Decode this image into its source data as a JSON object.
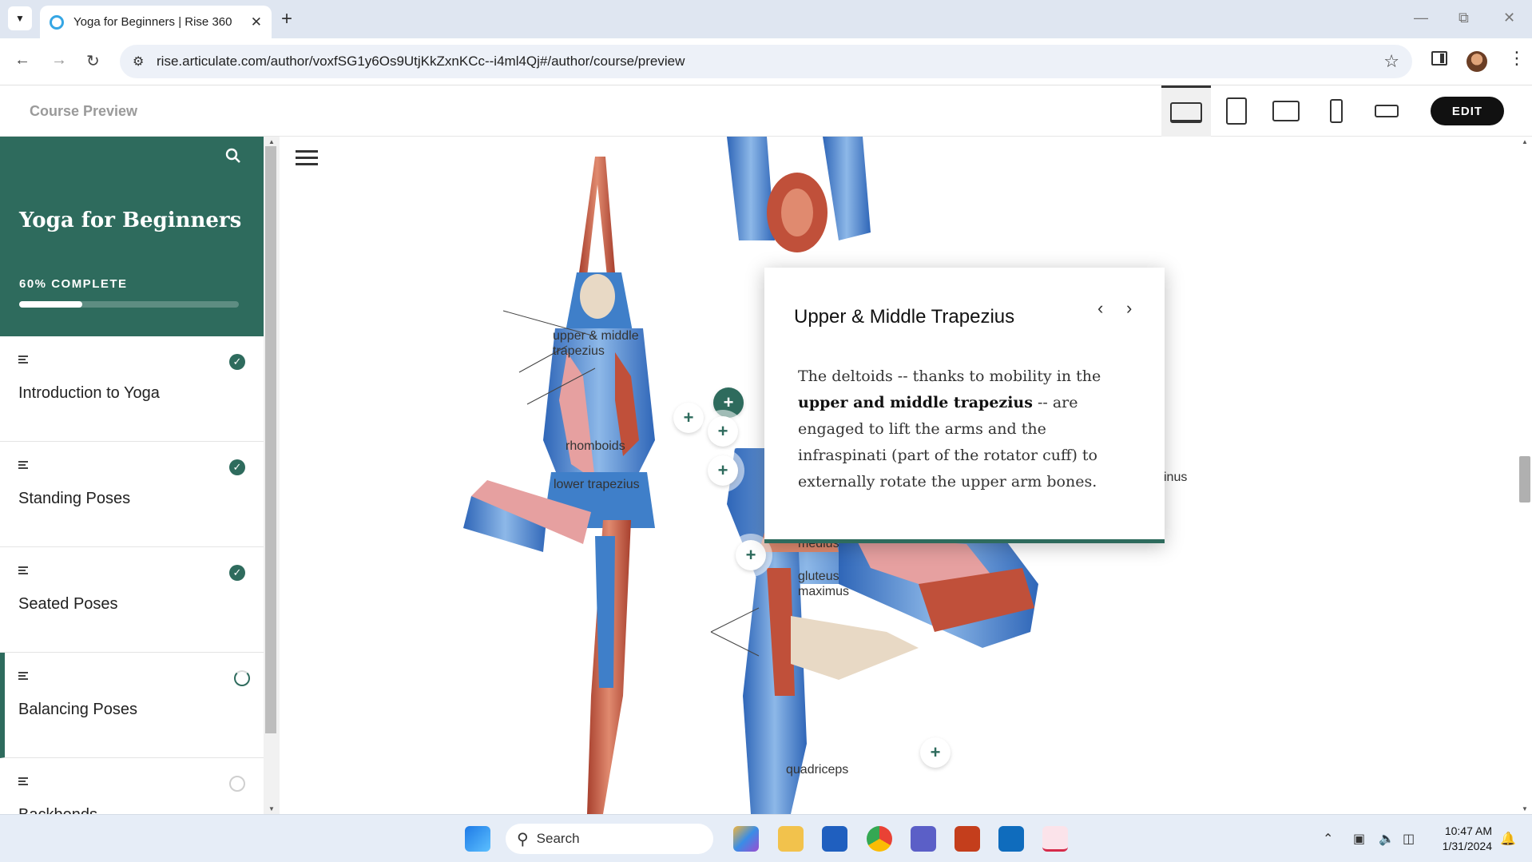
{
  "browser": {
    "tab_title": "Yoga for Beginners | Rise 360",
    "url": "rise.articulate.com/author/voxfSG1y6Os9UtjKkZxnKCc--i4ml4Qj#/author/course/preview"
  },
  "ribbon": {
    "title": "Course Preview",
    "edit_label": "EDIT"
  },
  "sidebar": {
    "course_title": "Yoga for Beginners",
    "progress_label": "60% COMPLETE",
    "progress": 0.6,
    "lessons": [
      {
        "label": "Introduction to Yoga",
        "status": "complete"
      },
      {
        "label": "Standing Poses",
        "status": "complete"
      },
      {
        "label": "Seated Poses",
        "status": "complete"
      },
      {
        "label": "Balancing Poses",
        "status": "in-progress"
      },
      {
        "label": "Backbends",
        "status": "not-started"
      }
    ]
  },
  "figure": {
    "labels": {
      "trap": "upper & middle trapezius",
      "rhomboids": "rhomboids",
      "lower_trap": "lower trapezius",
      "medius": "medius",
      "gluteus_max": "gluteus maximus",
      "minus": "inus",
      "quadriceps": "quadriceps"
    }
  },
  "popup": {
    "title": "Upper & Middle Trapezius",
    "text_1": "The deltoids -- thanks to mobility in the ",
    "text_bold": "upper and middle trapezius",
    "text_2": " -- are engaged to lift the arms and the infraspinati (part of the rotator cuff) to externally rotate the upper arm bones."
  },
  "taskbar": {
    "search_label": "Search",
    "time": "10:47 AM",
    "date": "1/31/2024"
  },
  "colors": {
    "brand": "#2e6b5d",
    "muscle_red": "#c0503a",
    "muscle_blue": "#3f7fc9"
  }
}
